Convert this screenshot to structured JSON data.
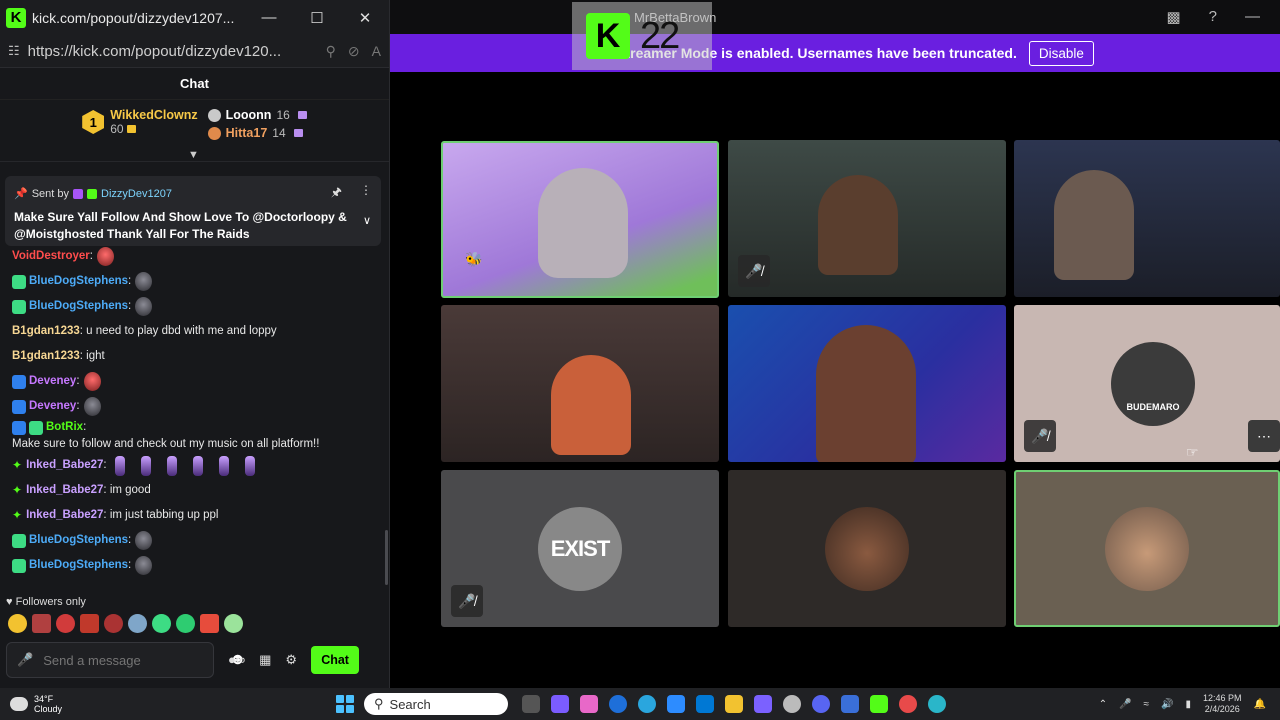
{
  "window": {
    "title": "kick.com/popout/dizzydev1207...",
    "url": "https://kick.com/popout/dizzydev120...",
    "logo": "K"
  },
  "chat": {
    "header": "Chat",
    "leaderboard": {
      "first": {
        "rank": "1",
        "name": "WikkedClownz",
        "points": "60"
      },
      "second": {
        "name": "Looonn",
        "points": "16"
      },
      "third": {
        "name": "Hitta17",
        "points": "14"
      }
    },
    "pinned": {
      "sent_by_label": "Sent by",
      "sender": "DizzyDev1207",
      "message": "Make Sure Yall Follow And Show Love To @Doctorloopy & @Moistghosted Thank Yall For The Raids"
    },
    "messages": [
      {
        "user": "VoidDestroyer",
        "text": "",
        "color": "#ff4d4d"
      },
      {
        "user": "BlueDogStephens",
        "text": "",
        "color": "#4dabf7"
      },
      {
        "user": "BlueDogStephens",
        "text": "",
        "color": "#4dabf7"
      },
      {
        "user": "B1gdan1233",
        "text": "u need to play dbd with me and loppy",
        "color": "#f7d794"
      },
      {
        "user": "B1gdan1233",
        "text": "ight",
        "color": "#f7d794"
      },
      {
        "user": "Deveney",
        "text": "",
        "color": "#c678ff"
      },
      {
        "user": "Deveney",
        "text": "",
        "color": "#c678ff"
      },
      {
        "user": "BotRix",
        "text": "Make sure to follow and check out my music on all platform!!",
        "color": "#53fc18"
      },
      {
        "user": "Inked_Babe27",
        "text": "",
        "color": "#c9a0ff"
      },
      {
        "user": "Inked_Babe27",
        "text": "im good",
        "color": "#c9a0ff"
      },
      {
        "user": "Inked_Babe27",
        "text": "im just tabbing up ppl",
        "color": "#c9a0ff"
      },
      {
        "user": "BlueDogStephens",
        "text": "",
        "color": "#4dabf7"
      },
      {
        "user": "BlueDogStephens",
        "text": "",
        "color": "#4dabf7"
      }
    ],
    "followers_only": "Followers only",
    "input_placeholder": "Send a message",
    "send_label": "Chat"
  },
  "main": {
    "streamer_name": "MrBettaBrown",
    "logo_overlay_text": "22",
    "banner_text": "Streamer Mode is enabled. Usernames have been truncated.",
    "disable_label": "Disable",
    "tile_avatar_labels": {
      "budemaro": "BUDEMARO",
      "exist": "EXIST"
    }
  },
  "taskbar": {
    "weather_temp": "34°F",
    "weather_desc": "Cloudy",
    "search_label": "Search",
    "time": "12:46 PM",
    "date": "2/4/2026"
  },
  "colors": {
    "kick_green": "#53fc18",
    "banner_purple": "#6a1fe0"
  }
}
